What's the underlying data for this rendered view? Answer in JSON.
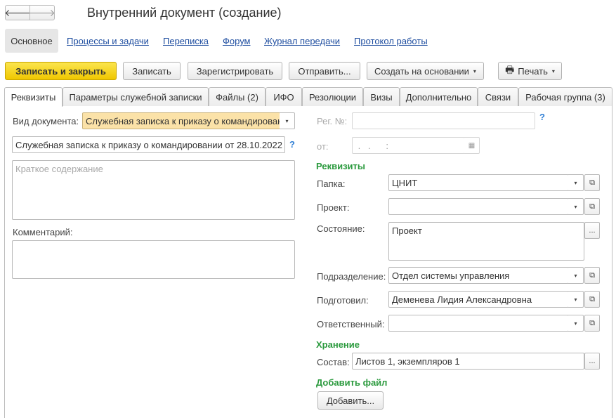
{
  "header": {
    "back_glyph": "🡐",
    "forward_glyph": "🡒",
    "title": "Внутренний документ (создание)"
  },
  "sections": {
    "active": "Основное",
    "links": [
      "Процессы и задачи",
      "Переписка",
      "Форум",
      "Журнал передачи",
      "Протокол работы"
    ]
  },
  "toolbar": {
    "save_close": "Записать и закрыть",
    "save": "Записать",
    "register": "Зарегистрировать",
    "send": "Отправить...",
    "create_based": "Создать на основании",
    "print": "Печать"
  },
  "tabs": [
    "Реквизиты",
    "Параметры служебной записки",
    "Файлы (2)",
    "ИФО",
    "Резолюции",
    "Визы",
    "Дополнительно",
    "Связи",
    "Рабочая группа (3)"
  ],
  "left": {
    "doc_type_label": "Вид документа:",
    "doc_type_value": "Служебная записка к приказу о командировани",
    "doc_name_value": "Служебная записка к приказу о командировании  от 28.10.2022",
    "help": "?",
    "summary_placeholder": "Краткое содержание",
    "comment_label": "Комментарий:"
  },
  "right": {
    "reg_label": "Рег. №:",
    "reg_value": "",
    "help": "?",
    "date_label": "от:",
    "date_value": " .   .      :",
    "requisites_title": "Реквизиты",
    "folder_label": "Папка:",
    "folder_value": "ЦНИТ",
    "project_label": "Проект:",
    "project_value": "",
    "state_label": "Состояние:",
    "state_value": "Проект",
    "dept_label": "Подразделение:",
    "dept_value": "Отдел системы управления",
    "prepared_label": "Подготовил:",
    "prepared_value": "Деменева Лидия Александровна",
    "responsible_label": "Ответственный:",
    "responsible_value": "",
    "storage_title": "Хранение",
    "composition_label": "Состав:",
    "composition_value": "Листов 1, экземпляров 1",
    "add_file_title": "Добавить файл",
    "add_button": "Добавить..."
  },
  "icons": {
    "dropdown": "▾",
    "open": "⧉",
    "ellipsis": "...",
    "calendar": "▦",
    "printer": "🖶"
  },
  "colors": {
    "primary_button": "#f5d31e",
    "link": "#1f4ea0",
    "section_title": "#2b9a3e",
    "help": "#2f7fd5",
    "highlight_field": "#fbe2a8"
  }
}
